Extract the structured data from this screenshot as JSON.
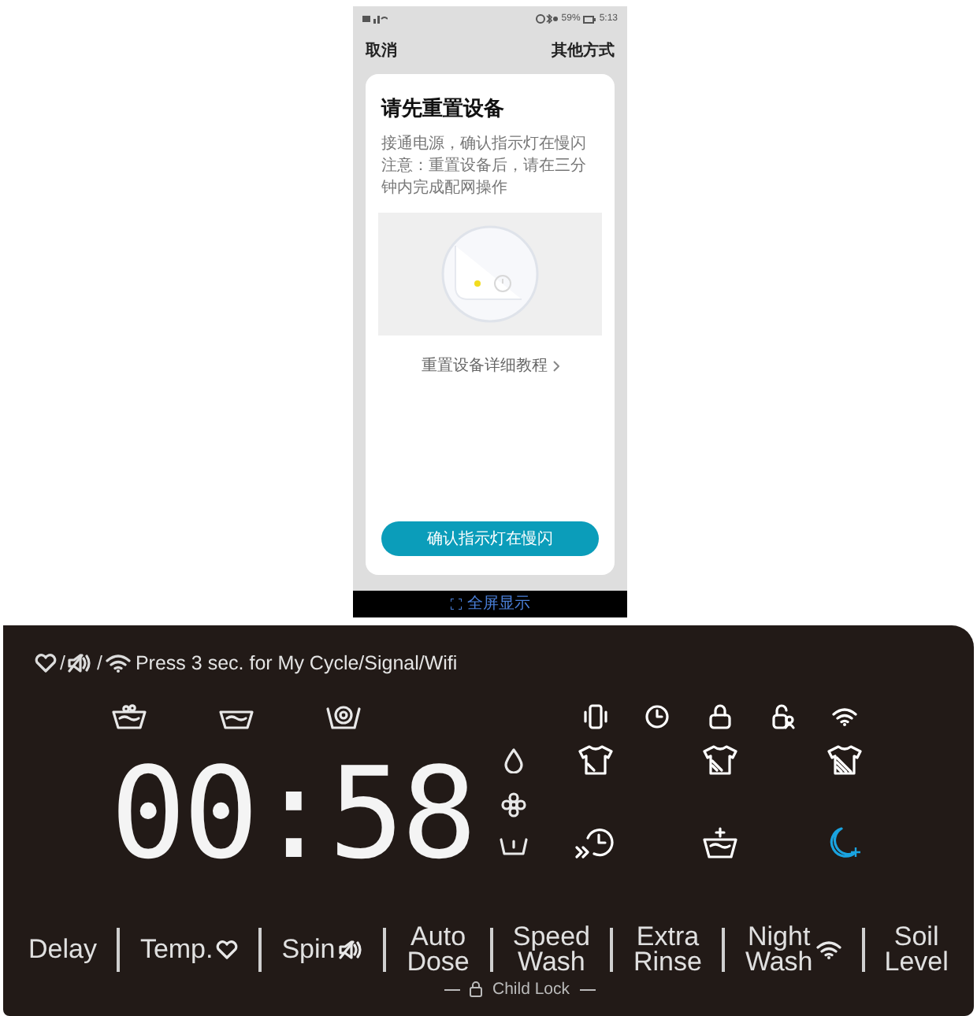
{
  "phone": {
    "status_bar": {
      "battery": "59%",
      "time": "5:13"
    },
    "nav": {
      "cancel": "取消",
      "other": "其他方式"
    },
    "card": {
      "title": "请先重置设备",
      "description": [
        "接通电源，确认指示灯在慢闪",
        "注意：重置设备后，请在三分钟内完成配网操作"
      ],
      "tutorial_link": "重置设备详细教程",
      "confirm_button": "确认指示灯在慢闪"
    },
    "bottom_bar": "全屏显示"
  },
  "panel": {
    "hint_icons": [
      {
        "kind": "heart"
      },
      {
        "kind": "mute"
      },
      {
        "kind": "wifi"
      }
    ],
    "hint_separator": "/",
    "hint": "Press 3 sec. for My Cycle/Signal/Wifi",
    "display": "00:58",
    "cycle_icons": [
      {
        "kind": "prewash"
      },
      {
        "kind": "wash"
      },
      {
        "kind": "spin"
      }
    ],
    "side_icons": [
      {
        "kind": "drop"
      },
      {
        "kind": "flower"
      },
      {
        "kind": "basin"
      }
    ],
    "indicators": [
      {
        "kind": "phone",
        "color": "#ffffff"
      },
      {
        "kind": "clock",
        "color": "#ffffff"
      },
      {
        "kind": "lock",
        "color": "#ffffff"
      },
      {
        "kind": "childlock",
        "color": "#ffffff"
      },
      {
        "kind": "wifi",
        "color": "#ffffff"
      },
      {
        "kind": "shirt1",
        "color": "#ffffff"
      },
      {
        "kind": "empty"
      },
      {
        "kind": "shirt2",
        "color": "#ffffff"
      },
      {
        "kind": "empty"
      },
      {
        "kind": "shirt3",
        "color": "#ffffff"
      },
      {
        "kind": "delayclock",
        "color": "#ffffff"
      },
      {
        "kind": "empty"
      },
      {
        "kind": "basinplus",
        "color": "#ffffff"
      },
      {
        "kind": "empty"
      },
      {
        "kind": "moon",
        "color": "#1aa3e0"
      }
    ],
    "buttons": [
      {
        "lines": [
          "Delay"
        ]
      },
      {
        "lines": [
          "Temp."
        ],
        "kind": "heart"
      },
      {
        "lines": [
          "Spin"
        ],
        "kind": "mute"
      },
      {
        "lines": [
          "Auto",
          "Dose"
        ]
      },
      {
        "lines": [
          "Speed",
          "Wash"
        ]
      },
      {
        "lines": [
          "Extra",
          "Rinse"
        ]
      },
      {
        "lines": [
          "Night",
          "Wash"
        ],
        "kind": "wifi"
      },
      {
        "lines": [
          "Soil",
          "Level"
        ]
      }
    ],
    "child_lock": "Child Lock"
  }
}
